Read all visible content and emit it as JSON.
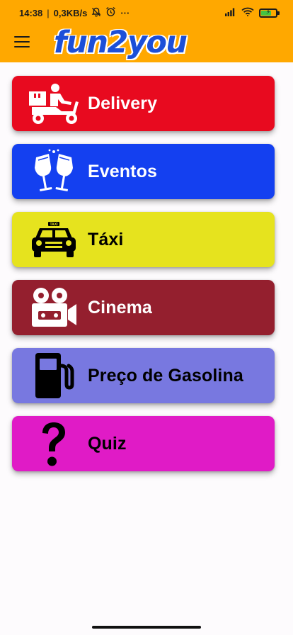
{
  "status_bar": {
    "time": "14:38",
    "separator": "|",
    "network_speed": "0,3KB/s",
    "overflow": "···",
    "icons": [
      "mute-bell-icon",
      "alarm-icon",
      "signal-icon",
      "wifi-icon",
      "battery-charging-icon"
    ]
  },
  "app_bar": {
    "logo_text": "fun2you",
    "menu_icon": "hamburger-menu-icon"
  },
  "menu": {
    "items": [
      {
        "label": "Delivery",
        "icon": "delivery-scooter-icon",
        "color": "#e80a1f",
        "text_color": "#ffffff"
      },
      {
        "label": "Eventos",
        "icon": "champagne-toast-icon",
        "color": "#1440f0",
        "text_color": "#ffffff"
      },
      {
        "label": "Táxi",
        "icon": "taxi-icon",
        "color": "#e6e31e",
        "text_color": "#000000"
      },
      {
        "label": "Cinema",
        "icon": "movie-camera-icon",
        "color": "#941f2e",
        "text_color": "#ffffff"
      },
      {
        "label": "Preço de Gasolina",
        "icon": "gas-pump-icon",
        "color": "#7878e0",
        "text_color": "#000000"
      },
      {
        "label": "Quiz",
        "icon": "question-mark-icon",
        "color": "#e01bc6",
        "text_color": "#000000"
      }
    ]
  },
  "colors": {
    "app_bar": "#ffa800",
    "logo": "#1c4fd8",
    "background": "#fdfbfd"
  }
}
